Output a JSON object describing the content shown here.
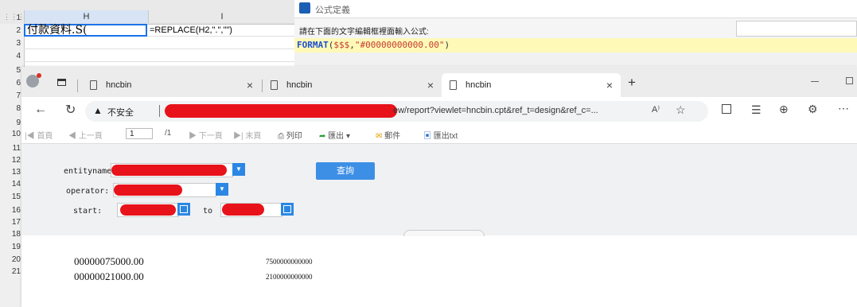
{
  "sheet": {
    "columns": [
      "H",
      "I"
    ],
    "rows": [
      "1",
      "2",
      "3",
      "4",
      "5",
      "6",
      "7",
      "8",
      "9",
      "10",
      "11",
      "12",
      "13",
      "14",
      "15",
      "16",
      "17",
      "18",
      "19",
      "20",
      "21"
    ],
    "cell_h2": "付款資料.S(",
    "cell_i2": "=REPLACE(H2,\".\",\"\")"
  },
  "dialog": {
    "title": "公式定義",
    "instruction": "請在下面的文字編輯框裡面輸入公式:",
    "formula_fn": "FORMAT",
    "formula_open": "(",
    "formula_arg1": "$$$",
    "formula_comma": ",",
    "formula_arg2": "\"#00000000000.00\"",
    "formula_close": ")"
  },
  "browser": {
    "tabs": [
      {
        "label": "hncbin",
        "close": "×"
      },
      {
        "label": "hncbin",
        "close": "×"
      },
      {
        "label": "hncbin",
        "close": "×"
      }
    ],
    "new_tab": "+",
    "insecure_label": "不安全",
    "url_visible": "ew/report?viewlet=hncbin.cpt&ref_t=design&ref_c=...",
    "read_aloud": "A⁾"
  },
  "report_toolbar": {
    "first": "首頁",
    "prev": "上一頁",
    "page": "1",
    "total": "/1",
    "next": "下一頁",
    "last": "末頁",
    "print": "列印",
    "export": "匯出",
    "email": "郵件",
    "export_txt": "匯出txt"
  },
  "params": {
    "entityname_label": "entityname:",
    "operator_label": "operator:",
    "start_label": "start:",
    "to_label": "to",
    "query_button": "查詢"
  },
  "report": {
    "rows": [
      {
        "formatted": "00000075000.00",
        "raw": "7500000000000"
      },
      {
        "formatted": "00000021000.00",
        "raw": "2100000000000"
      }
    ]
  },
  "colors": {
    "accent": "#2b87e3",
    "redaction": "#e8121a",
    "formula_bg": "#fff9b8"
  }
}
